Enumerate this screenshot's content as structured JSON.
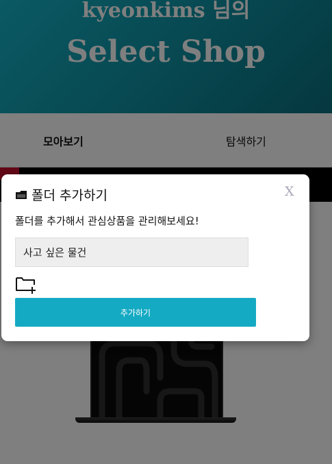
{
  "header": {
    "user_greeting": "kyeonkims 님의",
    "shop_title": "Select Shop"
  },
  "tabs": {
    "collect": "모아보기",
    "explore": "탐색하기"
  },
  "modal": {
    "title": "폴더 추가하기",
    "close_label": "X",
    "description": "폴더를 추가해서 관심상품을 관리해보세요!",
    "input_value": "사고 싶은 물건",
    "submit_label": "추가하기",
    "title_icon": "folder-icon",
    "add_icon": "folder-plus-icon"
  },
  "colors": {
    "accent": "#15aac3",
    "header_start": "#15b3c7",
    "header_end": "#0b6f7e",
    "close": "#a7a7b8"
  }
}
